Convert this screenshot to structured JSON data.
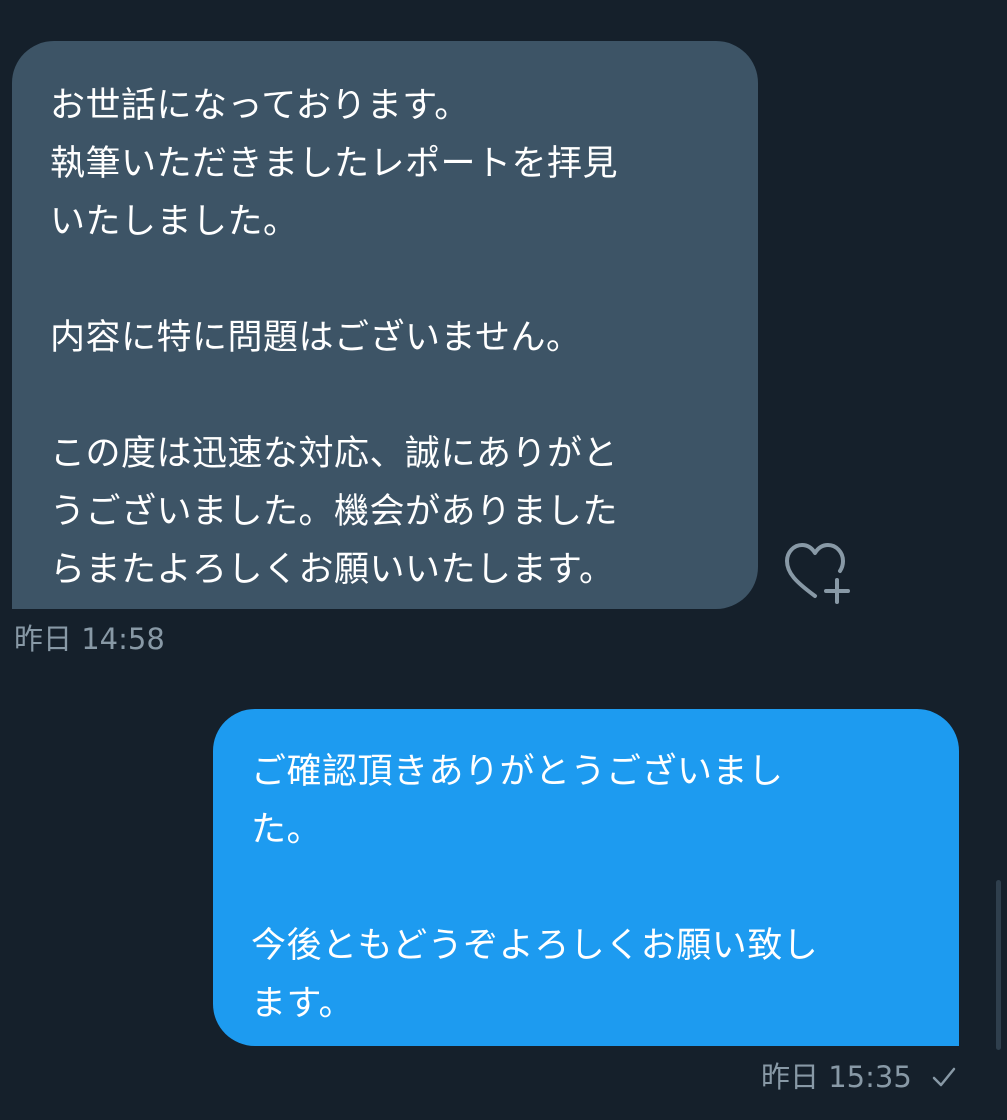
{
  "conversation": {
    "incoming_message": {
      "lines": [
        "お世話になっております。",
        "執筆いただきましたレポートを拝見",
        "いたしました。",
        "",
        "内容に特に問題はございません。",
        "",
        "この度は迅速な対応、誠にありがと",
        "うございました。機会がありました",
        "らまたよろしくお願いいたします。"
      ],
      "timestamp": "昨日 14:58",
      "bubble_color": "#3d5466"
    },
    "outgoing_message": {
      "lines": [
        "ご確認頂きありがとうございまし",
        "た。",
        "",
        "今後ともどうぞよろしくお願い致し",
        "ます。"
      ],
      "timestamp": "昨日 15:35",
      "status_icon": "check-icon",
      "bubble_color": "#1d9bf0"
    },
    "reaction_icon": "heart-plus-icon",
    "background_color": "#15202b"
  }
}
